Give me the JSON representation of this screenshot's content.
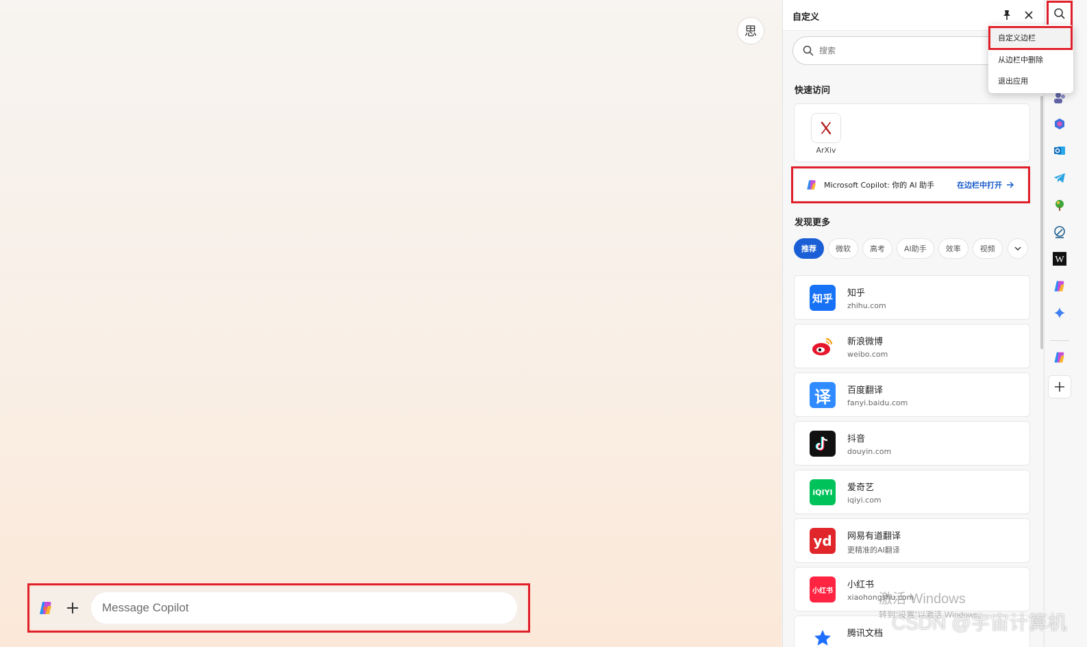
{
  "main": {
    "think_button_label": "思",
    "composer": {
      "placeholder": "Message Copilot"
    }
  },
  "panel": {
    "title": "自定义",
    "search_placeholder": "搜索",
    "quick_access_label": "快速访问",
    "quick_items": [
      {
        "label": "ArXiv"
      }
    ],
    "copilot_promo": {
      "text": "Microsoft Copilot: 你的 AI 助手",
      "action": "在边栏中打开"
    },
    "discover_label": "发现更多",
    "chips": [
      "推荐",
      "微软",
      "高考",
      "AI助手",
      "效率",
      "视频"
    ],
    "sites": [
      {
        "name": "知乎",
        "url": "zhihu.com",
        "icon_text": "知乎",
        "color": "#1772f6"
      },
      {
        "name": "新浪微博",
        "url": "weibo.com",
        "icon_text": "",
        "color": "#e6162d"
      },
      {
        "name": "百度翻译",
        "url": "fanyi.baidu.com",
        "icon_text": "译",
        "color": "#2f8bff"
      },
      {
        "name": "抖音",
        "url": "douyin.com",
        "icon_text": "",
        "color": "#111111"
      },
      {
        "name": "爱奇艺",
        "url": "iqiyi.com",
        "icon_text": "iQIYI",
        "color": "#00c25a"
      },
      {
        "name": "网易有道翻译",
        "url": "更精准的AI翻译",
        "icon_text": "yd",
        "color": "#e0262b"
      },
      {
        "name": "小红书",
        "url": "xiaohongshu.com",
        "icon_text": "小红书",
        "color": "#ff2442"
      },
      {
        "name": "腾讯文档",
        "url": "",
        "icon_text": "",
        "color": "#1e6fff"
      }
    ]
  },
  "context_menu": {
    "items": [
      "自定义边栏",
      "从边栏中删除",
      "退出应用"
    ]
  },
  "overlay": {
    "watermark_line1": "激活 Windows",
    "watermark_line2": "转到\"设置\"以激活 Windows。",
    "csdn": "CSDN @宇宙计算机"
  },
  "rail": {
    "icons": [
      "search-icon",
      "people-icon",
      "m365-icon",
      "outlook-icon",
      "telegram-icon",
      "tree-game-icon",
      "drawing-icon",
      "wikipedia-icon",
      "copilot-icon",
      "sparkle-icon",
      "copilot-icon",
      "add-icon"
    ]
  },
  "colors": {
    "accent": "#1a5fd6",
    "highlight_red": "#e01f2a",
    "link_blue": "#1559c9"
  }
}
